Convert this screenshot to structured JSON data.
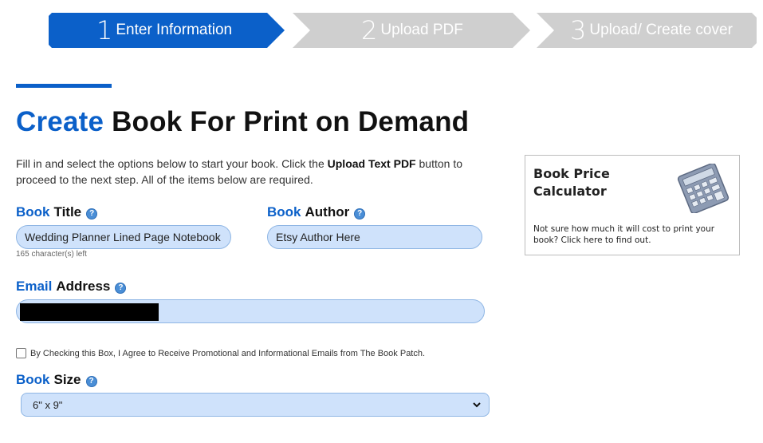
{
  "stepper": {
    "steps": [
      {
        "number": "1",
        "label": "Enter Information",
        "state": "active",
        "color": "#0b60c9"
      },
      {
        "number": "2",
        "label": "Upload PDF",
        "state": "inactive",
        "color": "#cfcfcf"
      },
      {
        "number": "3",
        "label": "Upload/ Create cover",
        "state": "inactive",
        "color": "#cfcfcf"
      }
    ]
  },
  "header": {
    "title_accent": "Create",
    "title_rest": " Book For Print on Demand",
    "intro_before": "Fill in and select the options below to start your book. Click the ",
    "intro_bold": "Upload Text PDF",
    "intro_after": " button to proceed to the next step. All of the items below are required."
  },
  "form": {
    "book_title": {
      "label_accent": "Book",
      "label_rest": "Title",
      "value": "Wedding Planner Lined Page Notebook",
      "char_count": "165 character(s) left"
    },
    "book_author": {
      "label_accent": "Book",
      "label_rest": "Author",
      "value": "Etsy Author Here"
    },
    "email": {
      "label_accent": "Email",
      "label_rest": "Address",
      "value": ""
    },
    "promo_checkbox": {
      "label": "By Checking this Box, I Agree to Receive Promotional and Informational Emails from The Book Patch.",
      "checked": false
    },
    "book_size": {
      "label_accent": "Book",
      "label_rest": "Size",
      "selected": "6\" x 9\""
    },
    "help_glyph": "?"
  },
  "calculator": {
    "title": "Book Price Calculator",
    "description": "Not sure how much it will cost to print your book? Click here to find out.",
    "icon": "calculator-icon"
  },
  "colors": {
    "accent": "#0b60c9",
    "input_bg": "#cfe2fb",
    "inactive_step": "#cfcfcf"
  }
}
